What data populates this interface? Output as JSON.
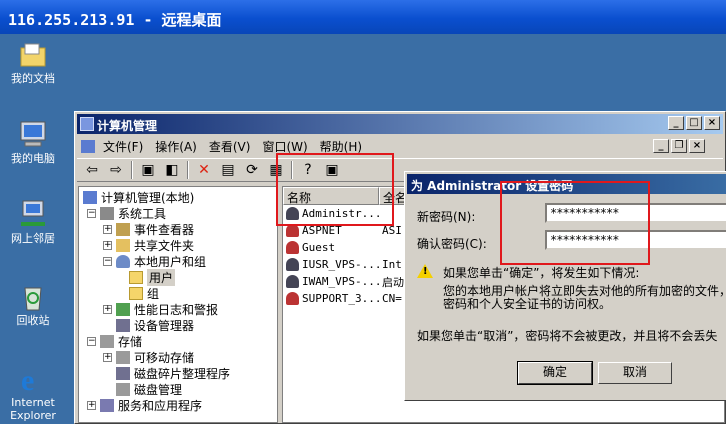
{
  "rdp": {
    "title": "116.255.213.91 - 远程桌面"
  },
  "desktop": {
    "icons": [
      {
        "label": "我的文档",
        "icon": "my-documents-icon"
      },
      {
        "label": "我的电脑",
        "icon": "my-computer-icon"
      },
      {
        "label": "网上邻居",
        "icon": "network-places-icon"
      },
      {
        "label": "回收站",
        "icon": "recycle-bin-icon"
      },
      {
        "label": "Internet Explorer",
        "icon": "ie-icon"
      }
    ]
  },
  "window": {
    "title": "计算机管理",
    "menu": [
      "文件(F)",
      "操作(A)",
      "查看(V)",
      "窗口(W)",
      "帮助(H)"
    ],
    "tree": {
      "root": "计算机管理(本地)",
      "system_tools": "系统工具",
      "event_viewer": "事件查看器",
      "shared_folders": "共享文件夹",
      "local_users": "本地用户和组",
      "users": "用户",
      "groups": "组",
      "perf_logs": "性能日志和警报",
      "device_manager": "设备管理器",
      "storage": "存储",
      "removable": "可移动存储",
      "defrag": "磁盘碎片整理程序",
      "disk_mgmt": "磁盘管理",
      "services": "服务和应用程序"
    },
    "list": {
      "headers": [
        "名称",
        "全名"
      ],
      "rows": [
        {
          "name": "Administr...",
          "full": ""
        },
        {
          "name": "ASPNET",
          "full": "ASI"
        },
        {
          "name": "Guest",
          "full": ""
        },
        {
          "name": "IUSR_VPS-...",
          "full": "Int"
        },
        {
          "name": "IWAM_VPS-...",
          "full": "启动"
        },
        {
          "name": "SUPPORT_3...",
          "full": "CN="
        }
      ]
    }
  },
  "dialog": {
    "title": "为 Administrator 设置密码",
    "new_pwd_label": "新密码(N):",
    "new_pwd_value": "***********",
    "confirm_label": "确认密码(C):",
    "confirm_value": "***********",
    "warn1": "如果您单击“确定”，将发生如下情况:",
    "warn2": "您的本地用户帐户将立即失去对他的所有加密的文件，",
    "warn3": "密码和个人安全证书的访问权。",
    "cancel_note": "如果您单击“取消”，密码将不会被更改，并且将不会丢失",
    "ok": "确定",
    "cancel": "取消"
  },
  "colors": {
    "highlight": "#e0181c",
    "desktop": "#3a6ea5",
    "title_active": "#0a246a"
  }
}
